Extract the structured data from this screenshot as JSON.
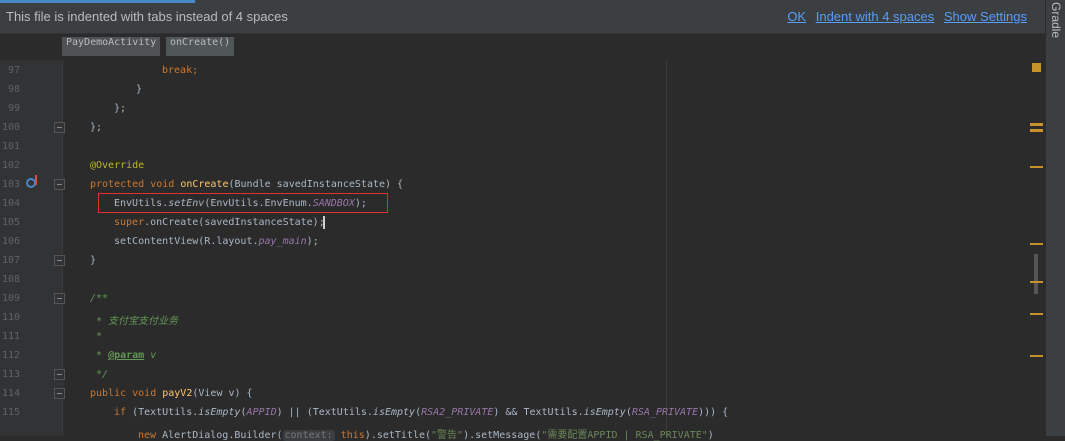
{
  "notification": {
    "message": "This file is indented with tabs instead of 4 spaces",
    "ok": "OK",
    "indent": "Indent with 4 spaces",
    "settings": "Show Settings"
  },
  "side_tool": "Gradle",
  "breadcrumbs": [
    "PayDemoActivity",
    "onCreate()"
  ],
  "line_numbers": [
    "97",
    "98",
    "99",
    "100",
    "101",
    "102",
    "103",
    "104",
    "105",
    "106",
    "107",
    "108",
    "109",
    "110",
    "111",
    "112",
    "113",
    "114",
    "115"
  ],
  "code": {
    "l97": "break;",
    "l98": "}",
    "l99": "};",
    "l100": "};",
    "l102": "@Override",
    "l103_kw": "protected void ",
    "l103_fn": "onCreate",
    "l103_rest": "(Bundle savedInstanceState) {",
    "l104_a": "EnvUtils.",
    "l104_b": "setEnv",
    "l104_c": "(EnvUtils.EnvEnum.",
    "l104_d": "SANDBOX",
    "l104_e": ");",
    "l105_kw": "super",
    "l105_rest": ".onCreate(savedInstanceState);",
    "l106_a": "setContentView(R.layout.",
    "l106_b": "pay_main",
    "l106_c": ");",
    "l107": "}",
    "l109": "/**",
    "l110": " * 支付宝支付业务",
    "l111": " *",
    "l112_a": " * ",
    "l112_b": "@param",
    "l112_c": " v",
    "l113": " */",
    "l114_kw": "public void ",
    "l114_fn": "payV2",
    "l114_rest": "(View v) {",
    "l115_kw": "if ",
    "l115_a": "(TextUtils.",
    "l115_b": "isEmpty",
    "l115_c": "(",
    "l115_d": "APPID",
    "l115_e": ") || (TextUtils.",
    "l115_f": "isEmpty",
    "l115_g": "(",
    "l115_h": "RSA2_PRIVATE",
    "l115_i": ") && TextUtils.",
    "l115_j": "isEmpty",
    "l115_k": "(",
    "l115_l": "RSA_PRIVATE",
    "l115_m": "))) {",
    "l116_kw": "new ",
    "l116_a": "AlertDialog.Builder(",
    "l116_hint": "context:",
    "l116_this": " this",
    "l116_b": ").setTitle(",
    "l116_s1": "\"警告\"",
    "l116_c": ").setMessage(",
    "l116_s2": "\"需要配置APPID | RSA_PRIVATE\"",
    "l116_d": ")"
  },
  "colors": {
    "accent": "#4a88c7",
    "highlight_box": "#e03030",
    "marker": "#c8922a"
  }
}
